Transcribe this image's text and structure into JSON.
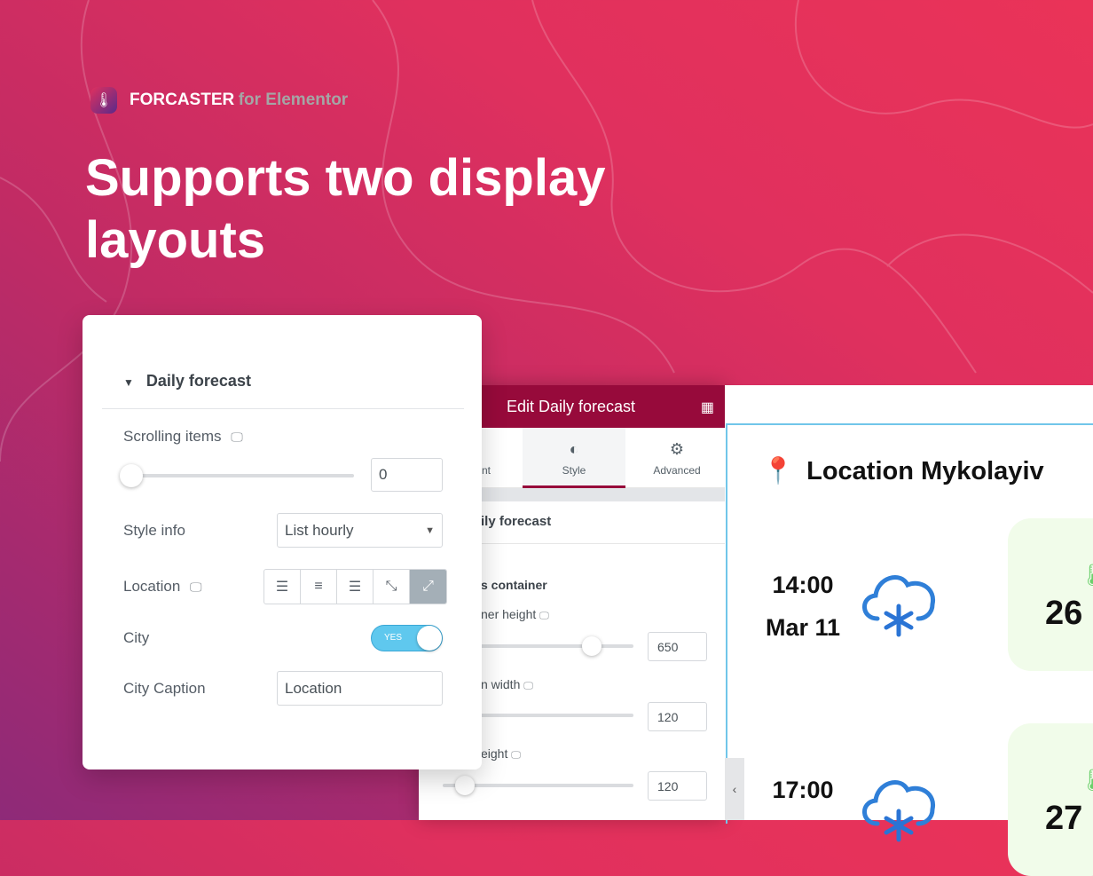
{
  "brand": {
    "name": "FORCASTER",
    "suffix": "for Elementor",
    "logo_icon": "thermometer-icon"
  },
  "headline": "Supports two display layouts",
  "colors": {
    "accent": "#970a3b",
    "toggle": "#5fc8ee",
    "temp_card": "#f1fcea",
    "preview_border": "#71c6ea"
  },
  "card": {
    "section_title": "Daily forecast",
    "scrolling_items": {
      "label": "Scrolling items",
      "value": "0",
      "slider_fraction": 0
    },
    "style_info": {
      "label": "Style info",
      "value": "List hourly"
    },
    "location": {
      "label": "Location",
      "options": [
        "align-left",
        "align-center",
        "align-right",
        "shrink",
        "expand"
      ],
      "selected": "expand"
    },
    "city": {
      "label": "City",
      "toggle": "YES",
      "on": true
    },
    "city_caption": {
      "label": "City Caption",
      "value": "Location"
    }
  },
  "editor": {
    "title": "Edit Daily forecast",
    "tabs": [
      {
        "label": "nt",
        "icon": "pencil-icon"
      },
      {
        "label": "Style",
        "icon": "contrast-icon"
      },
      {
        "label": "Advanced",
        "icon": "gear-icon"
      }
    ],
    "section": "ily forecast",
    "subsection": "s container",
    "fields": [
      {
        "label": "ner height",
        "value": "650"
      },
      {
        "label": "n width",
        "value": "120"
      },
      {
        "label": "eight",
        "value": "120"
      }
    ]
  },
  "preview": {
    "location": "Location Mykolayiv",
    "items": [
      {
        "time": "14:00",
        "date": "Mar 11",
        "temp": "26"
      },
      {
        "time": "17:00",
        "date": "",
        "temp": "27"
      }
    ]
  }
}
